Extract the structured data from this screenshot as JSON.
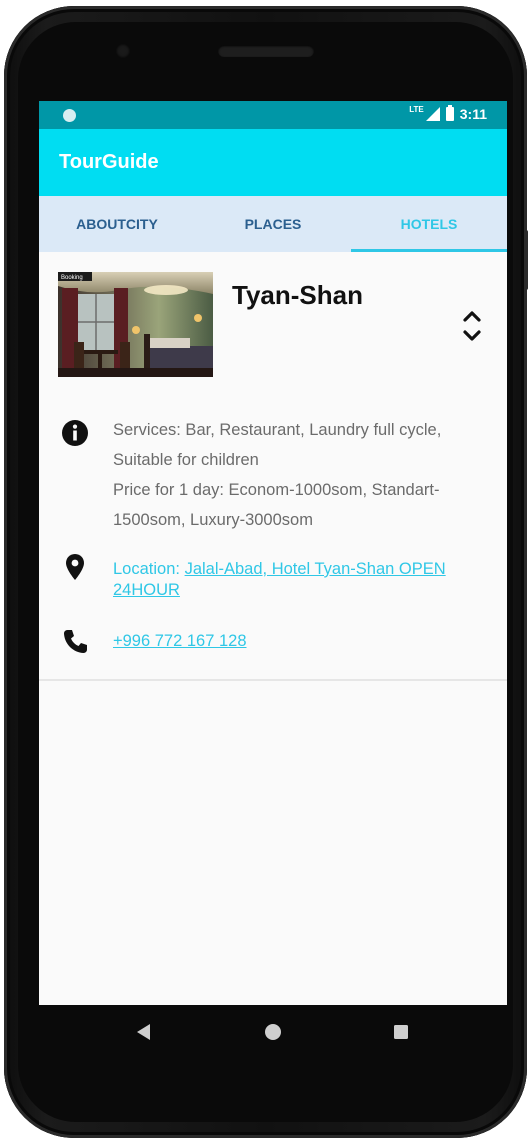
{
  "status_bar": {
    "time": "3:11",
    "network": "LTE"
  },
  "app_bar": {
    "title": "TourGuide"
  },
  "tabs": [
    {
      "label": "ABOUTCITY",
      "active": false
    },
    {
      "label": "PLACES",
      "active": false
    },
    {
      "label": "HOTELS",
      "active": true
    }
  ],
  "hotel": {
    "name": "Tyan-Shan",
    "photo_badge": "Booking",
    "description": "Services: Bar, Restaurant, Laundry full cycle, Suitable for children\n Price for 1 day: Econom-1000som, Standart-1500som, Luxury-3000som",
    "location_prefix": "Location: ",
    "location_link": "Jalal-Abad, Hotel Tyan-Shan OPEN 24HOUR",
    "phone": "+996 772 167 128"
  },
  "icons": {
    "info": "info-icon",
    "location": "location-pin-icon",
    "phone": "phone-icon",
    "expand": "expand-collapse-icon"
  },
  "colors": {
    "status_bar": "#0097a7",
    "app_bar": "#00ddf2",
    "tab_bar": "#dbe9f7",
    "tab_text": "#2b5f8f",
    "accent": "#2fc7e6",
    "body_text": "#6b6b6b"
  }
}
